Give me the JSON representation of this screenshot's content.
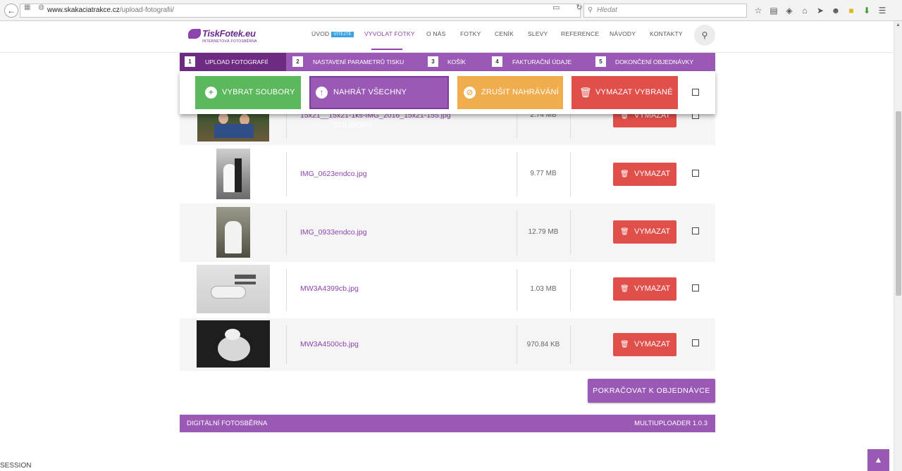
{
  "browser": {
    "back": "←",
    "url_domain": "www.skakaciatrakce.cz",
    "url_path": "/upload-fotografii/",
    "search_placeholder": "Hledat"
  },
  "header": {
    "logo_name": "TiskFotek.eu",
    "logo_sub": "INTERNETOVÁ  FOTOSBĚRNA",
    "nav": [
      {
        "label": "ÚVOD",
        "badge": "VÍTEJTE"
      },
      {
        "label": "VYVOLAT FOTKY"
      },
      {
        "label": "O NÁS"
      },
      {
        "label": "FOTKY"
      },
      {
        "label": "CENÍK"
      },
      {
        "label": "SLEVY"
      },
      {
        "label": "REFERENCE"
      },
      {
        "label": "NÁVODY"
      },
      {
        "label": "KONTAKTY"
      }
    ]
  },
  "steps": [
    {
      "num": "1",
      "label": "UPLOAD FOTOGRAFIÍ"
    },
    {
      "num": "2",
      "label": "NASTAVENÍ PARAMETRŮ TISKU"
    },
    {
      "num": "3",
      "label": "KOŠÍK"
    },
    {
      "num": "4",
      "label": "FAKTURAČNÍ ÚDAJE"
    },
    {
      "num": "5",
      "label": "DOKONČENÍ OBJEDNÁVKY"
    }
  ],
  "actions": {
    "select": "VYBRAT SOUBORY",
    "upload_all": "NAHRÁT VŠECHNY SOUBORY",
    "cancel": "ZRUŠIT NAHRÁVÁNÍ",
    "delete_selected": "VYMAZAT VYBRANÉ"
  },
  "colors": {
    "purple": "#9b59b6",
    "dark_purple": "#6d2c82",
    "green": "#5cb85c",
    "orange": "#f0ad4e",
    "red": "#e04f4a"
  },
  "files": [
    {
      "name": "15x21__15x21-1ks-IMG_2016_15x21-155.jpg",
      "size": "2.74 MB",
      "delete": "VYMAZAT"
    },
    {
      "name": "IMG_0623endco.jpg",
      "size": "9.77 MB",
      "delete": "VYMAZAT"
    },
    {
      "name": "IMG_0933endco.jpg",
      "size": "12.79 MB",
      "delete": "VYMAZAT"
    },
    {
      "name": "MW3A4399cb.jpg",
      "size": "1.03 MB",
      "delete": "VYMAZAT"
    },
    {
      "name": "MW3A4500cb.jpg",
      "size": "970.84 KB",
      "delete": "VYMAZAT"
    }
  ],
  "continue_label": "POKRAČOVAT K OBJEDNÁVCE",
  "footer": {
    "left": "DIGITÁLNÍ FOTOSBĚRNA",
    "right": "MULTIUPLOADER 1.0.3"
  },
  "session_text": "SESSION",
  "to_top": "▲"
}
